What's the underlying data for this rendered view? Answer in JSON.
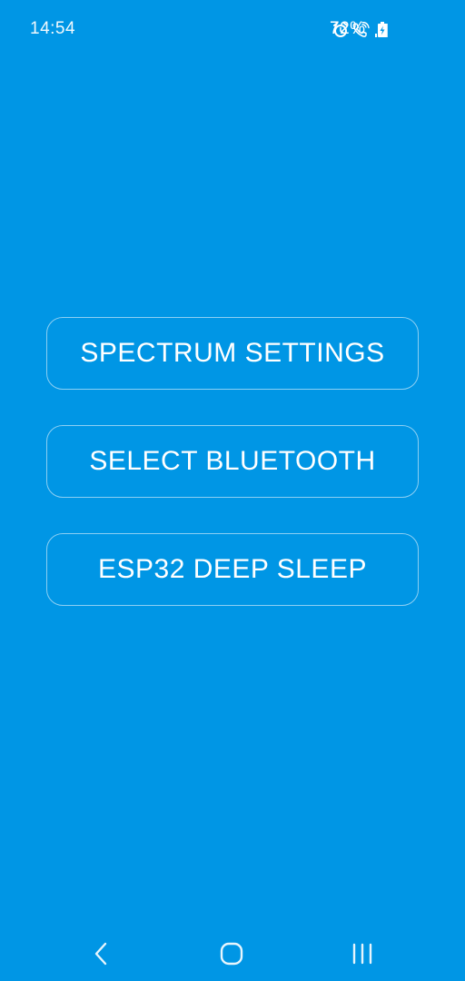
{
  "status_bar": {
    "time": "14:54",
    "battery_percent": "72%",
    "icons": [
      "alarm-icon",
      "wifi-calling-icon",
      "signal-icon",
      "battery-charging-icon"
    ]
  },
  "menu": {
    "buttons": [
      {
        "label": "SPECTRUM SETTINGS"
      },
      {
        "label": "SELECT BLUETOOTH"
      },
      {
        "label": "ESP32 DEEP SLEEP"
      }
    ]
  },
  "nav_bar": {
    "icons": [
      "back-icon",
      "home-icon",
      "recent-apps-icon"
    ]
  },
  "colors": {
    "background": "#0096E5",
    "foreground": "#FFFFFF"
  }
}
